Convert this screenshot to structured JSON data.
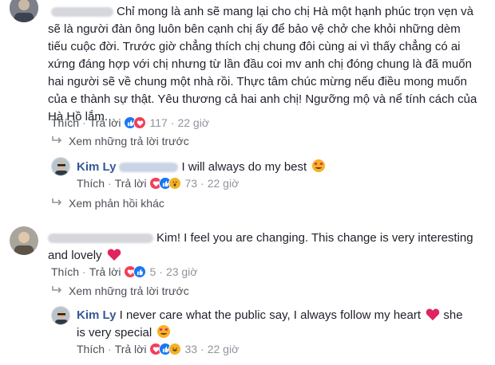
{
  "comments": [
    {
      "text_lines": [
        "Chỉ mong là anh sẽ mang lại cho chị Hà một hạnh phúc trọn vẹn và",
        "sẽ là người đàn ông luôn bên cạnh chị ấy để bảo vệ chở che khỏi những dèm",
        "tiếu cuộc đời. Trước giờ chẳng thích chị chung đôi cùng ai vì thấy chẳng có ai",
        "xứng đáng hợp với chị nhưng từ lần đầu coi mv anh chị đóng chung là đã muốn",
        "hai người sẽ về chung một nhà rồi. Thực tâm chúc mừng nếu điều mong muốn",
        "của e thành sự thật. Yêu thương cả hai anh chị! Ngưỡng mộ và nể tính cách của",
        "Hà Hồ lắm."
      ],
      "like_label": "Thích",
      "reply_label": "Trả lời",
      "reaction_count": "117",
      "time": "22 giờ"
    },
    {
      "text_lines": [
        "Kim! I feel you are changing. This change is very interesting",
        "and lovely"
      ],
      "like_label": "Thích",
      "reply_label": "Trả lời",
      "reaction_count": "5",
      "time": "23 giờ"
    }
  ],
  "replies": [
    {
      "author": "Kim Ly",
      "text": "I will always do my best",
      "like_label": "Thích",
      "reply_label": "Trả lời",
      "reaction_count": "73",
      "time": "22 giờ"
    },
    {
      "author": "Kim Ly",
      "text_lines": [
        "I never care what the public say, I always follow my heart",
        "is very special"
      ],
      "text_after_heart": "she",
      "like_label": "Thích",
      "reply_label": "Trả lời",
      "reaction_count": "33",
      "time": "22 giờ"
    }
  ],
  "links": {
    "prev_replies_1": "Xem những trả lời trước",
    "other_replies": "Xem phản hồi khác",
    "prev_replies_2": "Xem những trả lời trước"
  },
  "colors": {
    "link_blue": "#365899",
    "meta_grey": "#90949c",
    "like_blue": "#1877f2",
    "love_red": "#f33e58",
    "haha_yellow": "#f7b125"
  },
  "icons": [
    "like-reaction-icon",
    "love-reaction-icon",
    "wow-reaction-icon",
    "haha-reaction-icon",
    "heart-emoji-icon",
    "heart-eyes-emoji-icon",
    "reply-arrow-icon"
  ]
}
